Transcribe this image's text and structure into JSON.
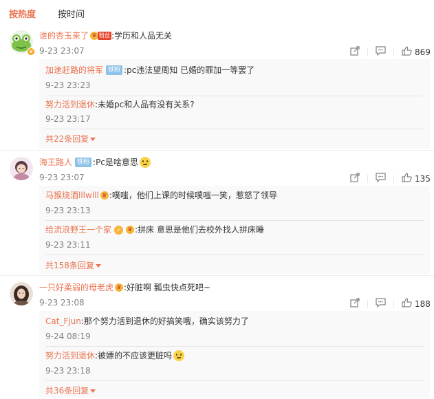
{
  "tabs": {
    "hot": "按热度",
    "time": "按时间"
  },
  "comments": [
    {
      "user": "谁的杏玉来了",
      "fan_label": "粉丝",
      "text": ":学历和人品无关",
      "time": "9-23 23:07",
      "likes": "869",
      "replies": [
        {
          "user": "加速赶路的将军",
          "tag": "铁粉",
          "text": ":pc违法望周知 已婚的罪加一等罢了",
          "time": "9-23 23:23"
        },
        {
          "user": "努力活到退休",
          "text": ":未婚pc和人品有没有关系?",
          "time": "9-23 23:17"
        }
      ],
      "more": "共22条回复"
    },
    {
      "user": "海王路人",
      "tag": "铁粉",
      "text": ":Pc是啥意思",
      "time": "9-23 23:07",
      "likes": "135",
      "replies": [
        {
          "user": "马猴烧酒lllwlll",
          "text": ":噗嗤，他们上课的时候噗嗤一笑，惹怒了领导",
          "time": "9-23 23:13"
        },
        {
          "user": "给流浪野王一个家",
          "text": ":拼床 意思是他们去校外找人拼床睡",
          "time": "9-23 23:11"
        }
      ],
      "more": "共158条回复"
    },
    {
      "user": "一只好柔弱的母老虎",
      "text": ":好脏啊 瓢虫快点死吧~",
      "time": "9-23 23:08",
      "likes": "188",
      "replies": [
        {
          "user": "Cat_Fjun",
          "text": ":那个努力活到退休的好搞笑哦，确实该努力了",
          "time": "9-24 08:19"
        },
        {
          "user": "努力活到退休",
          "text": ":被嫖的不应该更脏吗",
          "time": "9-23 23:18"
        }
      ],
      "more": "共36条回复"
    }
  ],
  "icons": {
    "share": "share-icon",
    "comment": "comment-icon",
    "like": "thumbs-up-icon",
    "more": "triangle-down-icon"
  },
  "colors": {
    "accent": "#eb7350",
    "tag": "#8fc2e8",
    "muted": "#808080",
    "reply_bg": "#f9f9f9"
  }
}
